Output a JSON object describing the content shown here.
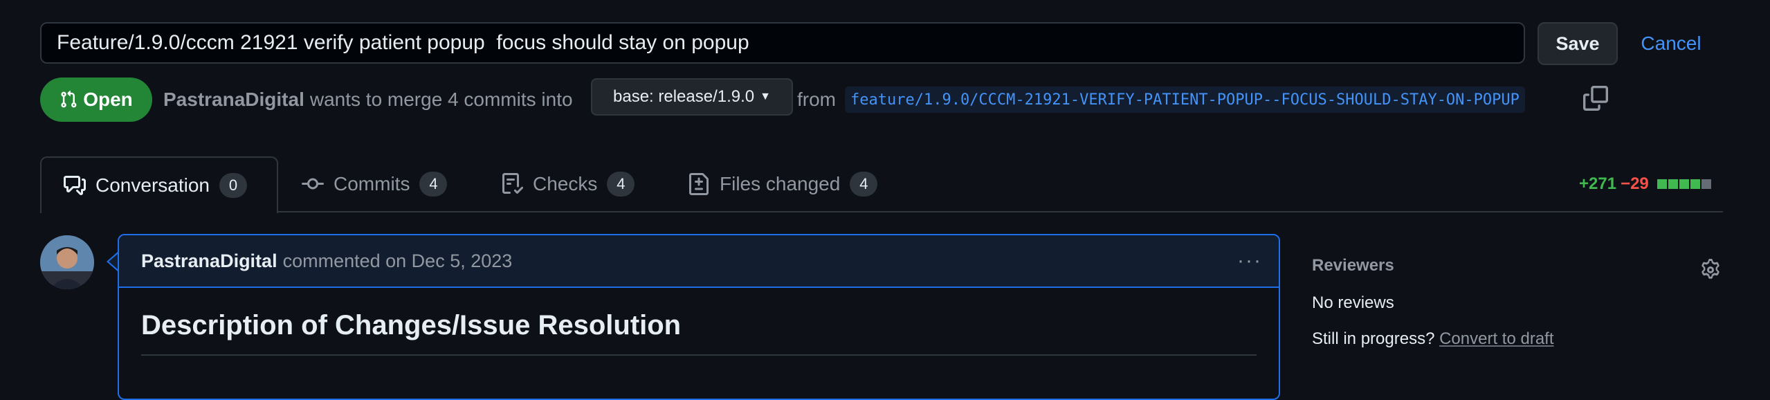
{
  "title_edit": {
    "value": "Feature/1.9.0/cccm 21921 verify patient popup  focus should stay on popup",
    "save_label": "Save",
    "cancel_label": "Cancel"
  },
  "meta": {
    "state": "Open",
    "author": "PastranaDigital",
    "merge_text": "wants to merge 4 commits into",
    "base_branch": "base: release/1.9.0",
    "from_text": "from",
    "head_branch": "feature/1.9.0/CCCM-21921-VERIFY-PATIENT-POPUP--FOCUS-SHOULD-STAY-ON-POPUP"
  },
  "tabs": [
    {
      "label": "Conversation",
      "count": "0",
      "icon": "comment-discussion-icon"
    },
    {
      "label": "Commits",
      "count": "4",
      "icon": "git-commit-icon"
    },
    {
      "label": "Checks",
      "count": "4",
      "icon": "checklist-icon"
    },
    {
      "label": "Files changed",
      "count": "4",
      "icon": "file-diff-icon"
    }
  ],
  "diffstat": {
    "additions": "+271",
    "deletions": "−29",
    "blocks": [
      "add",
      "add",
      "add",
      "add",
      "neutral"
    ],
    "colors": {
      "add": "#3fb950",
      "neutral": "#656c76"
    }
  },
  "comment": {
    "author": "PastranaDigital",
    "action": "commented on Dec 5, 2023",
    "heading": "Description of Changes/Issue Resolution"
  },
  "sidebar": {
    "reviewers_label": "Reviewers",
    "no_reviews": "No reviews",
    "still_in_progress": "Still in progress?",
    "convert_to_draft": "Convert to draft"
  },
  "colors": {
    "background": "#0d1117",
    "accent_blue": "#4493f8",
    "open_green": "#238636"
  }
}
